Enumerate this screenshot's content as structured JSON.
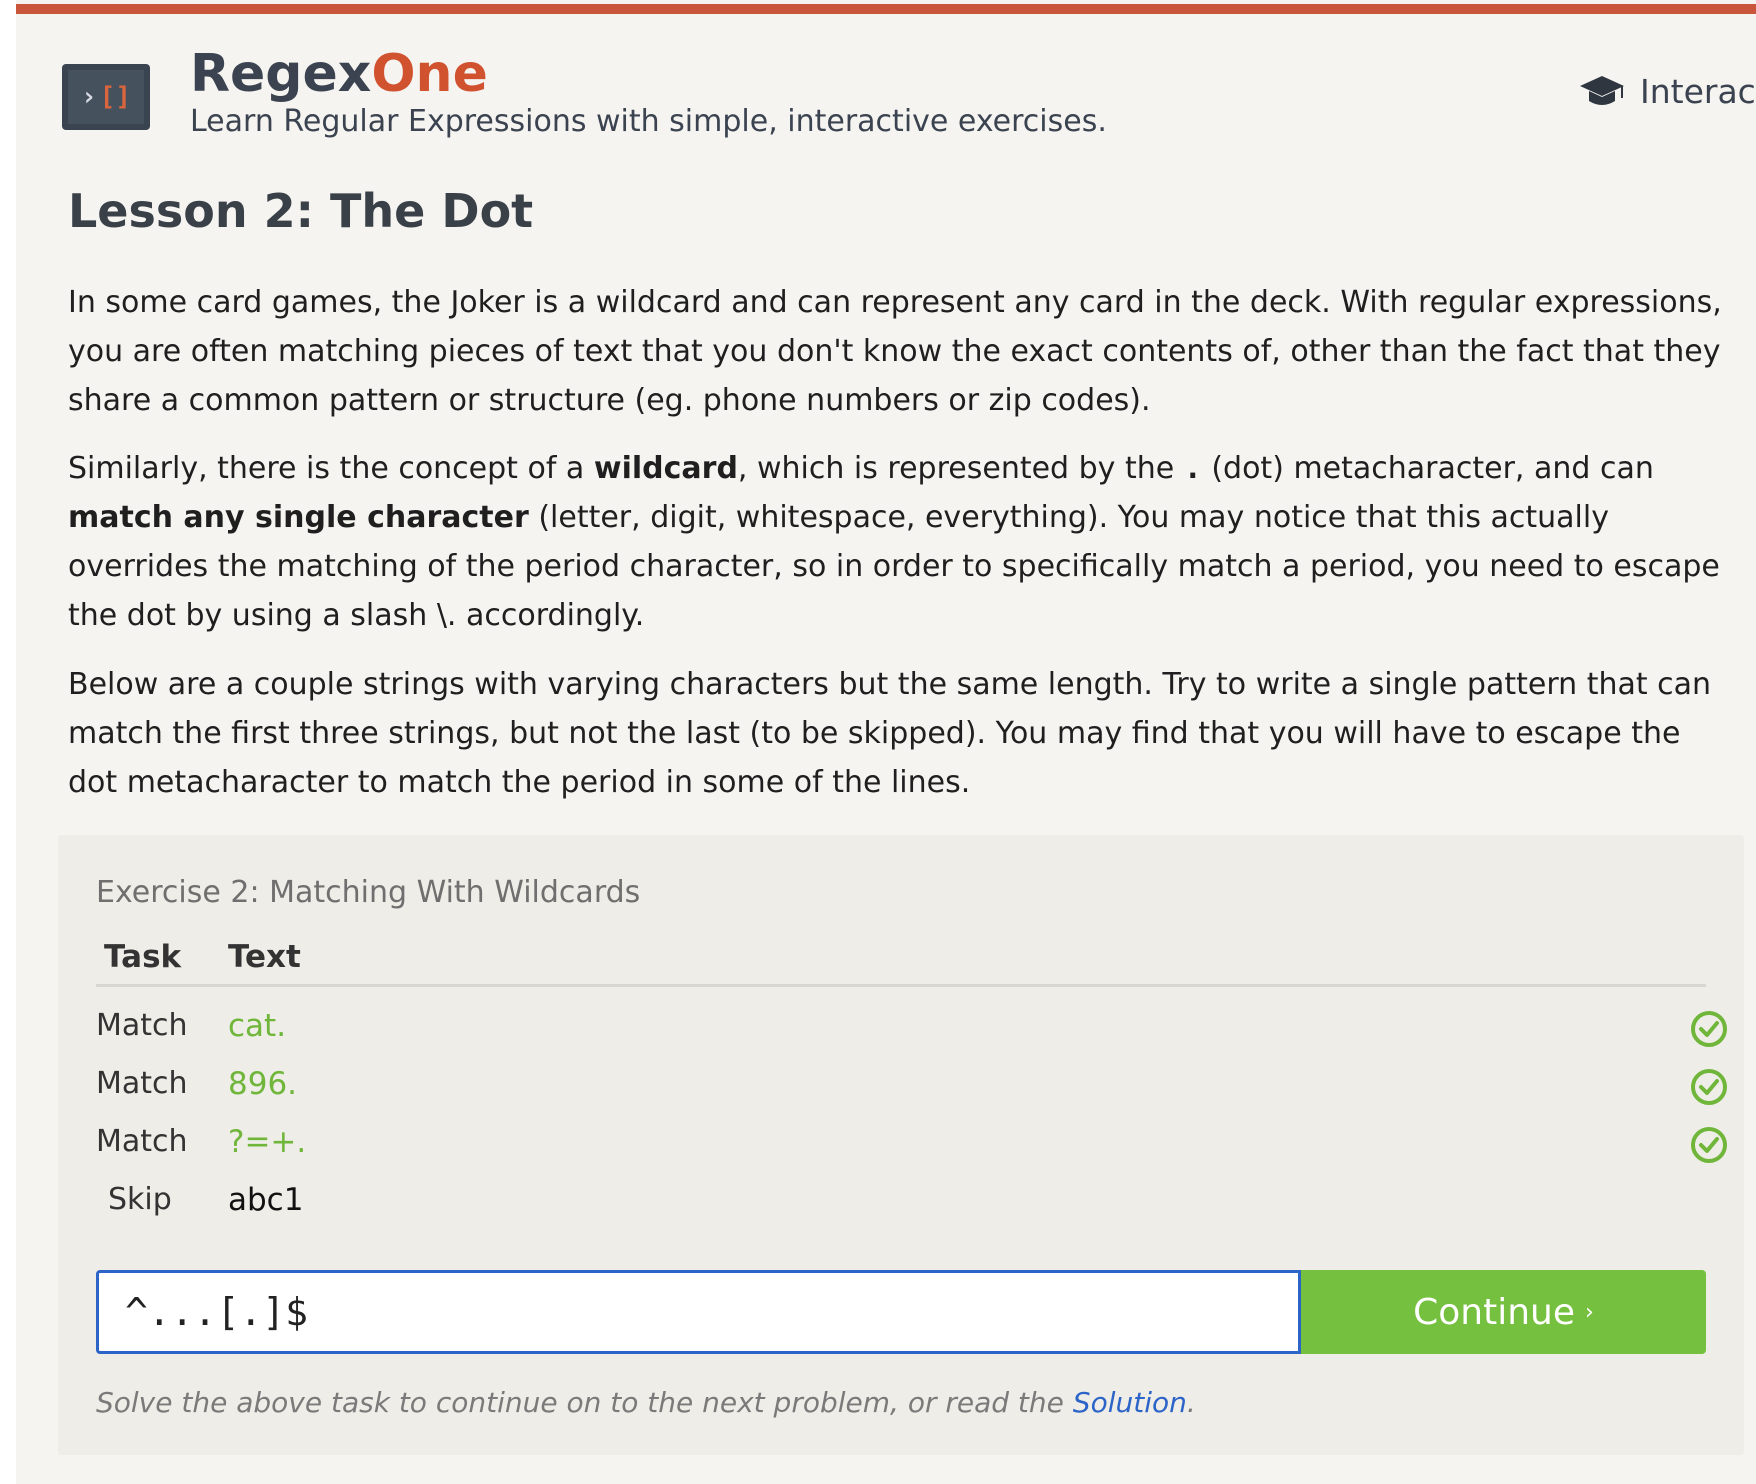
{
  "brand": {
    "name_part1": "Regex",
    "name_part2": "One",
    "tagline": "Learn Regular Expressions with simple, interactive exercises.",
    "logo_glyph_left": "›",
    "logo_glyph_right": "[]"
  },
  "header_nav": {
    "label": "Interac",
    "icon": "graduation-cap-icon"
  },
  "lesson": {
    "title": "Lesson 2: The Dot",
    "p1": "In some card games, the Joker is a wildcard and can represent any card in the deck. With regular expressions, you are often matching pieces of text that you don't know the exact contents of, other than the fact that they share a common pattern or structure (eg. phone numbers or zip codes).",
    "p2_a": "Similarly, there is the concept of a ",
    "p2_b": "wildcard",
    "p2_c": ", which is represented by the ",
    "p2_d": ".",
    "p2_e": " (dot) metacharacter, and can ",
    "p2_f": "match any single character",
    "p2_g": " (letter, digit, whitespace, everything). You may notice that this actually overrides the matching of the period character, so in order to specifically match a period, you need to escape the dot by using a slash \\. accordingly.",
    "p3": "Below are a couple strings with varying characters but the same length. Try to write a single pattern that can match the first three strings, but not the last (to be skipped). You may find that you will have to escape the dot metacharacter to match the period in some of the lines."
  },
  "exercise": {
    "title": "Exercise 2: Matching With Wildcards",
    "col_task": "Task",
    "col_text": "Text",
    "rows": [
      {
        "task": "Match",
        "text": "cat.",
        "status": "pass"
      },
      {
        "task": "Match",
        "text": "896.",
        "status": "pass"
      },
      {
        "task": "Match",
        "text": "?=+.",
        "status": "pass"
      },
      {
        "task": "Skip",
        "text": "abc1",
        "status": "none"
      }
    ],
    "input_value": "^...[.]$",
    "continue_label": "Continue",
    "continue_chevron": "›",
    "note_before": "Solve the above task to continue on to the next problem, or read the ",
    "note_link": "Solution",
    "note_after": "."
  },
  "colors": {
    "accent_bar": "#c9553b",
    "brand_one": "#d0522f",
    "match_green": "#6fb63a",
    "continue_green": "#75c13f",
    "link_blue": "#2d64c8"
  }
}
